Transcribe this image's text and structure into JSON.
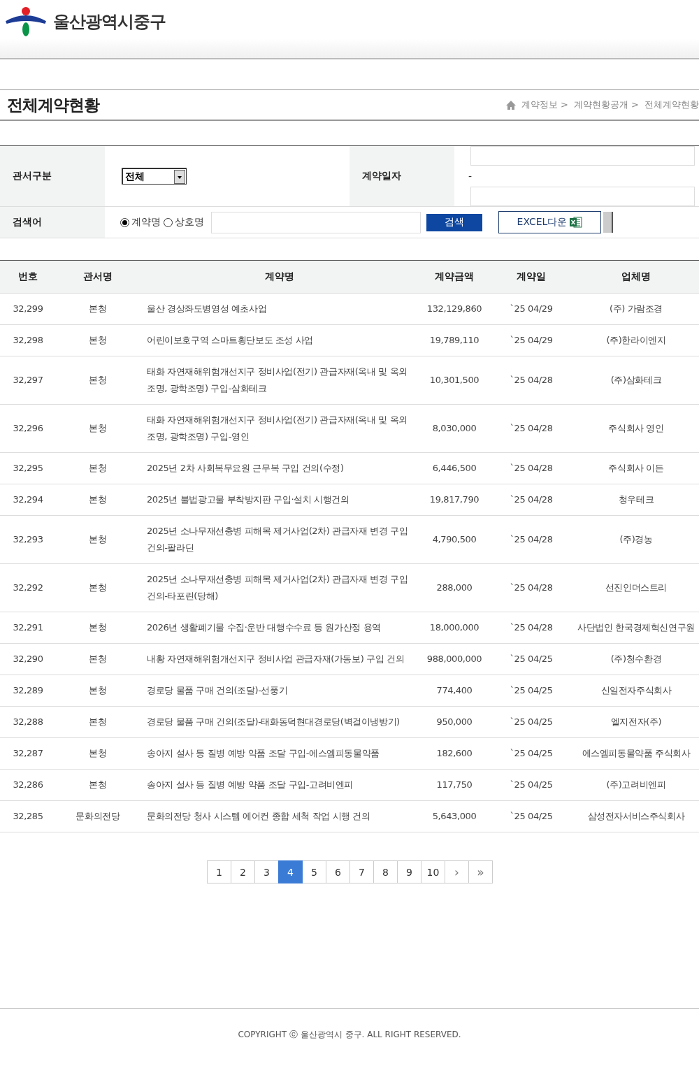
{
  "site": {
    "name": "울산광역시중구"
  },
  "page": {
    "title": "전체계약현황",
    "breadcrumb": [
      "계약정보 >",
      "계약현황공개 >",
      "전체계약현황"
    ]
  },
  "search": {
    "office_label": "관서구분",
    "office_value": "전체",
    "date_label": "계약일자",
    "date_separator": "-",
    "keyword_label": "검색어",
    "modes": [
      {
        "label": "계약명",
        "selected": true
      },
      {
        "label": "상호명",
        "selected": false
      }
    ],
    "search_button": "검색",
    "excel_button": "EXCEL다운"
  },
  "table": {
    "columns": [
      "번호",
      "관서명",
      "계약명",
      "계약금액",
      "계약일",
      "업체명"
    ],
    "rows": [
      [
        "32,299",
        "본청",
        "울산 경상좌도병영성 예초사업",
        "132,129,860",
        "`25 04/29",
        "(주) 가람조경"
      ],
      [
        "32,298",
        "본청",
        "어린이보호구역 스마트횡단보도 조성 사업",
        "19,789,110",
        "`25 04/29",
        "(주)한라이엔지"
      ],
      [
        "32,297",
        "본청",
        "태화 자연재해위험개선지구 정비사업(전기) 관급자재(옥내 및 옥외조명, 광학조명) 구입-삼화테크",
        "10,301,500",
        "`25 04/28",
        "(주)삼화테크"
      ],
      [
        "32,296",
        "본청",
        "태화 자연재해위험개선지구 정비사업(전기) 관급자재(옥내 및 옥외조명, 광학조명) 구입-영인",
        "8,030,000",
        "`25 04/28",
        "주식회사 영인"
      ],
      [
        "32,295",
        "본청",
        "2025년 2차 사회복무요원 근무복 구입 건의(수정)",
        "6,446,500",
        "`25 04/28",
        "주식회사 이든"
      ],
      [
        "32,294",
        "본청",
        "2025년 불법광고물 부착방지판 구입·설치 시행건의",
        "19,817,790",
        "`25 04/28",
        "청우테크"
      ],
      [
        "32,293",
        "본청",
        "2025년 소나무재선충병 피해목 제거사업(2차) 관급자재 변경 구입 건의-팔라딘",
        "4,790,500",
        "`25 04/28",
        "(주)경농"
      ],
      [
        "32,292",
        "본청",
        "2025년 소나무재선충병 피해목 제거사업(2차) 관급자재 변경 구입 건의-타포린(당해)",
        "288,000",
        "`25 04/28",
        "선진인더스트리"
      ],
      [
        "32,291",
        "본청",
        "2026년 생활폐기물 수집·운반 대행수수료 등 원가산정 용역",
        "18,000,000",
        "`25 04/28",
        "사단법인 한국경제혁신연구원"
      ],
      [
        "32,290",
        "본청",
        "내황 자연재해위험개선지구 정비사업 관급자재(가동보) 구입 건의",
        "988,000,000",
        "`25 04/25",
        "(주)청수환경"
      ],
      [
        "32,289",
        "본청",
        "경로당 물품 구매 건의(조달)-선풍기",
        "774,400",
        "`25 04/25",
        "신일전자주식회사"
      ],
      [
        "32,288",
        "본청",
        "경로당 물품 구매 건의(조달)-태화동덕현대경로당(벽걸이냉방기)",
        "950,000",
        "`25 04/25",
        "엘지전자(주)"
      ],
      [
        "32,287",
        "본청",
        "송아지 설사 등 질병 예방 약품 조달 구입-에스엠피동물약품",
        "182,600",
        "`25 04/25",
        "에스엠피동물약품 주식회사"
      ],
      [
        "32,286",
        "본청",
        "송아지 설사 등 질병 예방 약품 조달 구입-고려비엔피",
        "117,750",
        "`25 04/25",
        "(주)고려비엔피"
      ],
      [
        "32,285",
        "문화의전당",
        "문화의전당 청사 시스템 에어컨 종합 세척 작업 시행 건의",
        "5,643,000",
        "`25 04/25",
        "삼성전자서비스주식회사"
      ]
    ]
  },
  "pagination": {
    "pages": [
      {
        "label": "1",
        "selected": false
      },
      {
        "label": "2",
        "selected": false
      },
      {
        "label": "3",
        "selected": false
      },
      {
        "label": "4",
        "selected": true
      },
      {
        "label": "5",
        "selected": false
      },
      {
        "label": "6",
        "selected": false
      },
      {
        "label": "7",
        "selected": false
      },
      {
        "label": "8",
        "selected": false
      },
      {
        "label": "9",
        "selected": false
      },
      {
        "label": "10",
        "selected": false
      }
    ],
    "next": "›",
    "last": "»"
  },
  "footer": {
    "copyright": "COPYRIGHT ⓒ 울산광역시 중구. ALL RIGHT RESERVED."
  }
}
